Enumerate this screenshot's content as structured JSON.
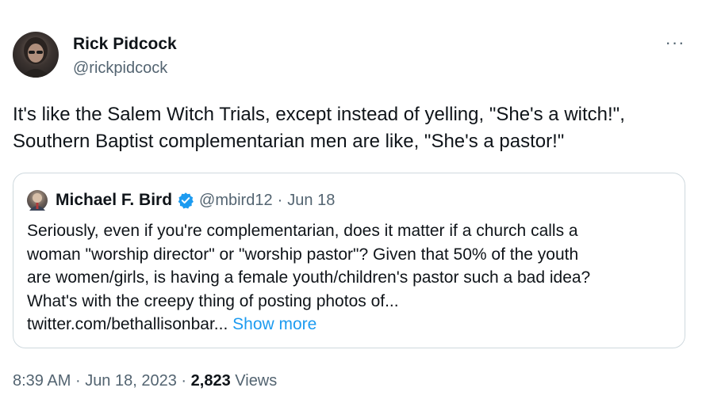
{
  "author": {
    "name": "Rick Pidcock",
    "handle": "@rickpidcock",
    "avatar_icon": "profile-photo"
  },
  "more_icon_label": "···",
  "tweet_text": {
    "line1": "It's like the Salem Witch Trials, except instead of yelling, \"She's a witch!\",",
    "line2": "Southern Baptist complementarian men are like, \"She's a pastor!\""
  },
  "quoted": {
    "name": "Michael F. Bird",
    "handle": "@mbird12",
    "separator": "·",
    "date": "Jun 18",
    "verified_color": "#1d9bf0",
    "lines": [
      "Seriously, even if you're complementarian, does it matter if a church calls a",
      "woman \"worship director\" or \"worship pastor\"? Given that 50% of the youth",
      "are women/girls, is having a female youth/children's pastor such a bad idea?",
      "What's with the creepy thing of posting photos of..."
    ],
    "link": "twitter.com/bethallisonbar...",
    "show_more": "Show more"
  },
  "meta": {
    "time": "8:39 AM",
    "sep1": "·",
    "date": "Jun 18, 2023",
    "sep2": "·",
    "views_count": "2,823",
    "views_label": "Views"
  },
  "colors": {
    "text": "#0f1419",
    "secondary": "#536471",
    "accent": "#1d9bf0",
    "border": "#cfd9de"
  }
}
